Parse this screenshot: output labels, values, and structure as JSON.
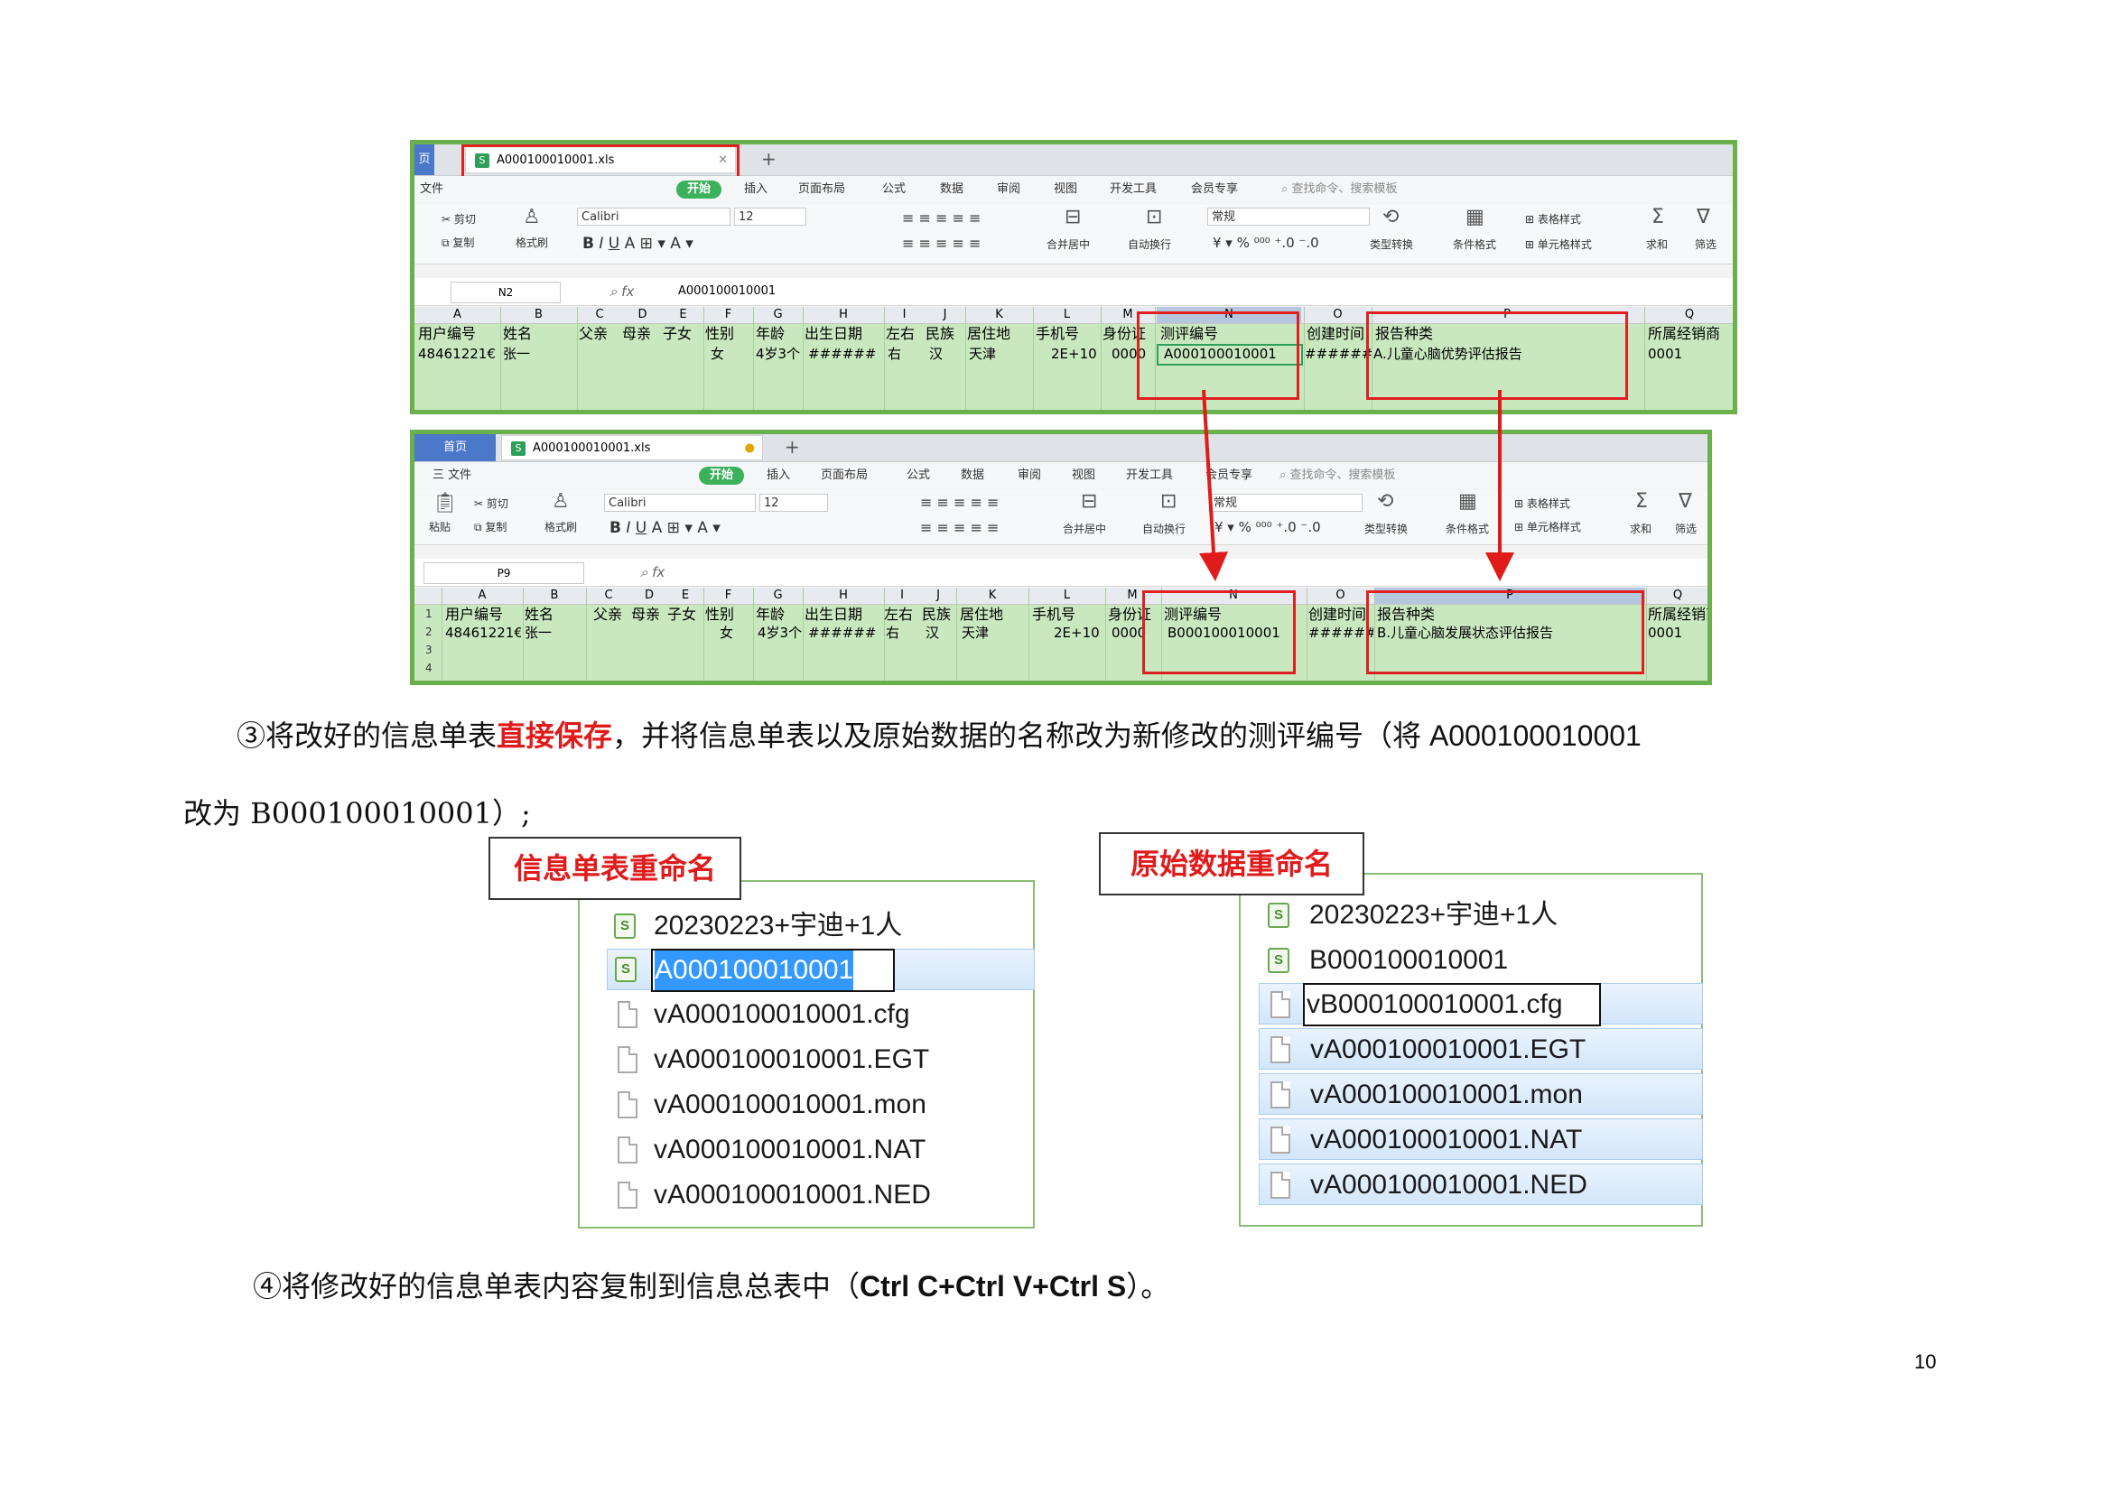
{
  "sheet1": {
    "home_tab": "页",
    "file_tab": "A000100010001.xls",
    "menu": [
      "文件",
      "开始",
      "插入",
      "页面布局",
      "公式",
      "数据",
      "审阅",
      "视图",
      "开发工具",
      "会员专享"
    ],
    "search": "查找命令、搜索模板",
    "ribbon": {
      "cut": "剪切",
      "copy": "复制",
      "format_painter": "格式刷",
      "font": "Calibri",
      "size": "12",
      "merge": "合并居中",
      "wrap": "自动换行",
      "number_format": "常规",
      "convert": "类型转换",
      "cond_format": "条件格式",
      "table_style": "表格样式",
      "cell_style": "单元格样式",
      "sum": "求和",
      "filter": "筛选"
    },
    "name_box": "N2",
    "formula": "A000100010001",
    "columns": [
      "A",
      "B",
      "C",
      "D",
      "E",
      "F",
      "G",
      "H",
      "I",
      "J",
      "K",
      "L",
      "M",
      "N",
      "O",
      "P",
      "Q"
    ],
    "row1": [
      "用户编号",
      "姓名",
      "父亲",
      "母亲",
      "子女",
      "性别",
      "年龄",
      "出生日期",
      "左右",
      "民族",
      "居住地",
      "手机号",
      "身份证",
      "测评编号",
      "创建时间",
      "报告种类",
      "所属经销商"
    ],
    "row2": [
      "48461221€",
      "张一",
      "女",
      "4岁3个",
      "######",
      "右",
      "汉",
      "天津",
      "2E+10",
      "0000",
      "A000100010001",
      "########",
      "A.儿童心脑优势评估报告",
      "0001"
    ]
  },
  "sheet2": {
    "home_tab": "首页",
    "file_tab": "A000100010001.xls",
    "menu": [
      "三 文件",
      "开始",
      "插入",
      "页面布局",
      "公式",
      "数据",
      "审阅",
      "视图",
      "开发工具",
      "会员专享"
    ],
    "search": "查找命令、搜索模板",
    "ribbon": {
      "paste": "粘贴",
      "cut": "剪切",
      "copy": "复制",
      "format_painter": "格式刷",
      "font": "Calibri",
      "size": "12",
      "merge": "合并居中",
      "wrap": "自动换行",
      "number_format": "常规",
      "convert": "类型转换",
      "cond_format": "条件格式",
      "table_style": "表格样式",
      "cell_style": "单元格样式",
      "sum": "求和",
      "filter": "筛选"
    },
    "name_box": "P9",
    "columns": [
      "A",
      "B",
      "C",
      "D",
      "E",
      "F",
      "G",
      "H",
      "I",
      "J",
      "K",
      "L",
      "M",
      "N",
      "O",
      "P",
      "Q"
    ],
    "row_numbers": [
      "1",
      "2",
      "3",
      "4"
    ],
    "row1": [
      "用户编号",
      "姓名",
      "父亲",
      "母亲",
      "子女",
      "性别",
      "年龄",
      "出生日期",
      "左右",
      "民族",
      "居住地",
      "手机号",
      "身份证",
      "测评编号",
      "创建时间",
      "报告种类",
      "所属经销商"
    ],
    "row2": [
      "48461221€",
      "张一",
      "女",
      "4岁3个",
      "######",
      "右",
      "汉",
      "天津",
      "2E+10",
      "0000",
      "B000100010001",
      "########",
      "B.儿童心脑发展状态评估报告",
      "0001"
    ]
  },
  "step3": {
    "num": "③",
    "pre": "将改好的信息单表",
    "highlight": "直接保存",
    "post": "，并将信息单表以及原始数据的名称改为新修改的测评编号（将 A000100010001",
    "line2": "改为 B000100010001）;"
  },
  "left_panel": {
    "callout": "信息单表重命名",
    "items": [
      "20230223+宇迪+1人",
      "A000100010001",
      "vA000100010001.cfg",
      "vA000100010001.EGT",
      "vA000100010001.mon",
      "vA000100010001.NAT",
      "vA000100010001.NED"
    ]
  },
  "right_panel": {
    "callout": "原始数据重命名",
    "items": [
      "20230223+宇迪+1人",
      "B000100010001",
      "vB000100010001.cfg",
      "vA000100010001.EGT",
      "vA000100010001.mon",
      "vA000100010001.NAT",
      "vA000100010001.NED"
    ]
  },
  "step4": {
    "num": "④",
    "pre": "将修改好的信息单表内容复制到信息总表中（",
    "keys": "Ctrl C+Ctrl V+Ctrl S",
    "post": "）。"
  },
  "page_number": "10",
  "colors": {
    "accent_green": "#6ab04c",
    "highlight_red": "#e01b1b",
    "sheet_bg": "#c9e8c0"
  }
}
